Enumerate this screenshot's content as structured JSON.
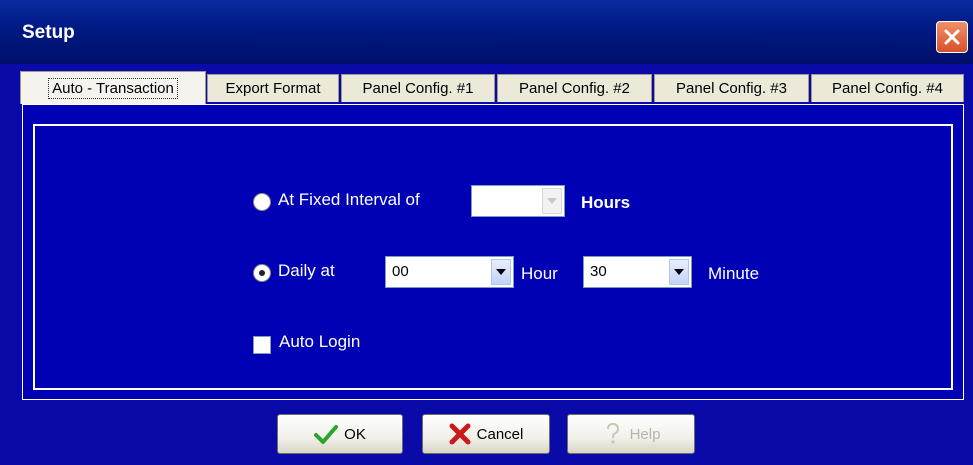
{
  "window": {
    "title": "Setup"
  },
  "tabs": [
    {
      "label": "Auto - Transaction",
      "active": true
    },
    {
      "label": "Export Format",
      "active": false
    },
    {
      "label": "Panel Config. #1",
      "active": false
    },
    {
      "label": "Panel Config. #2",
      "active": false
    },
    {
      "label": "Panel Config. #3",
      "active": false
    },
    {
      "label": "Panel Config. #4",
      "active": false
    }
  ],
  "form": {
    "fixed_interval": {
      "label": "At Fixed Interval of",
      "selected": false,
      "value": "",
      "unit": "Hours"
    },
    "daily": {
      "label": "Daily at",
      "selected": true,
      "hour_value": "00",
      "hour_unit": "Hour",
      "minute_value": "30",
      "minute_unit": "Minute"
    },
    "auto_login": {
      "label": "Auto Login",
      "checked": false
    }
  },
  "buttons": {
    "ok": "OK",
    "cancel": "Cancel",
    "help": "Help"
  },
  "colors": {
    "background": "#0000b4",
    "titlebar": "#001b86",
    "tab": "#ece9d8",
    "close": "#d6512a"
  },
  "icons": {
    "close": "close-icon",
    "ok": "checkmark-icon",
    "cancel": "x-icon",
    "help": "question-icon",
    "dropdown": "chevron-down-icon"
  }
}
